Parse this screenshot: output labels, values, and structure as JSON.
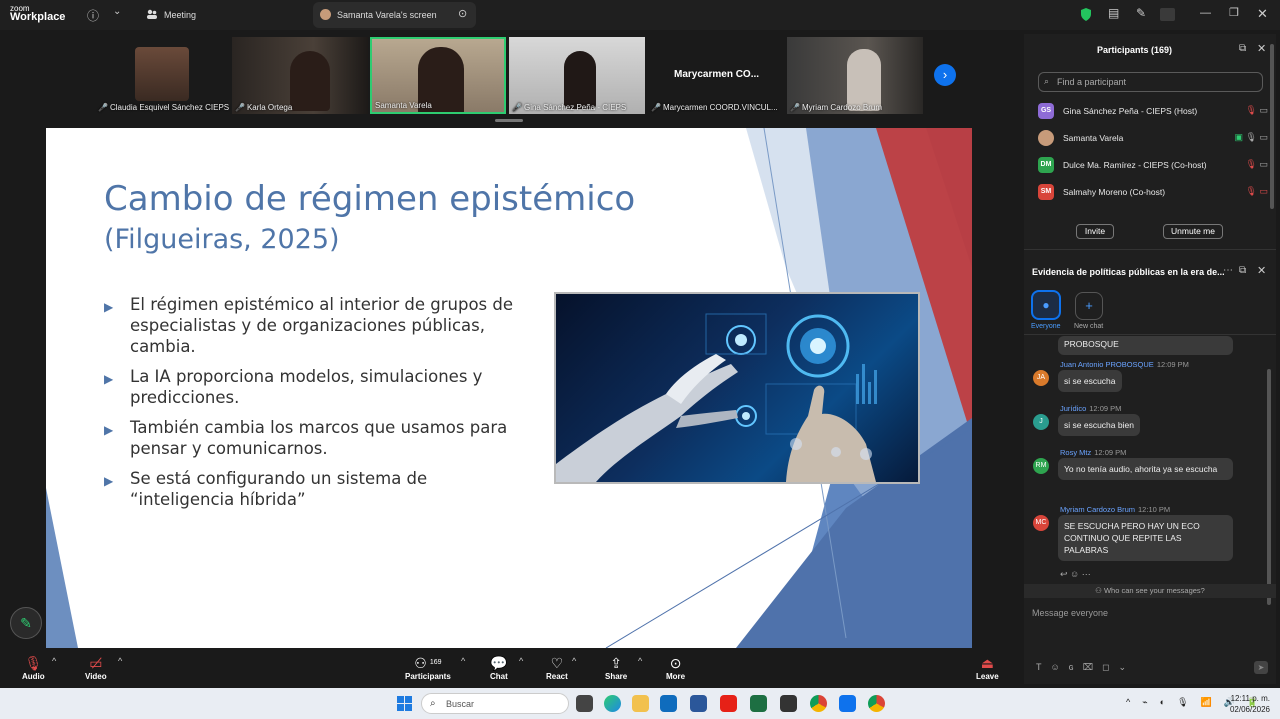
{
  "titlebar": {
    "logo_top": "zoom",
    "logo_bottom": "Workplace",
    "meeting_tab": "Meeting",
    "screen_tab": "Samanta Varela's screen"
  },
  "participants_strip": [
    {
      "name": "Claudia Esquivel Sánchez CIEPS",
      "muted": true
    },
    {
      "name": "Karla Ortega",
      "muted": true
    },
    {
      "name": "Samanta Varela",
      "muted": false
    },
    {
      "name": "Gina Sánchez Peña - CIEPS",
      "muted": true
    },
    {
      "name": "Marycarmen COORD.VINCUL...",
      "muted": true,
      "display": "Marycarmen  CO..."
    },
    {
      "name": "Myriam Cardozo Brum",
      "muted": true
    }
  ],
  "slide": {
    "title_main": "Cambio de régimen epistémico",
    "title_cite": "(Filgueiras, 2025)",
    "bullets": [
      "El régimen epistémico al interior de grupos de especialistas y de organizaciones públicas, cambia.",
      "La IA proporciona modelos, simulaciones y predicciones.",
      "También cambia los marcos que usamos para pensar y comunicarnos.",
      "Se está configurando un sistema de “inteligencia híbrida”"
    ]
  },
  "participants_panel": {
    "title": "Participants (169)",
    "search_placeholder": "Find a participant",
    "people": [
      {
        "initials": "GS",
        "name": "Gina Sánchez Peña - CIEPS (Host)",
        "color": "#8e6bd6"
      },
      {
        "initials": "",
        "name": "Samanta Varela",
        "color": "#c79b7a"
      },
      {
        "initials": "DM",
        "name": "Dulce Ma. Ramírez - CIEPS (Co-host)",
        "color": "#2ea44f"
      },
      {
        "initials": "SM",
        "name": "Salmahy Moreno (Co-host)",
        "color": "#d8453a"
      }
    ],
    "invite_label": "Invite",
    "unmute_label": "Unmute me"
  },
  "chat_panel": {
    "title": "Evidencia de políticas públicas en la era de...",
    "tab_everyone": "Everyone",
    "tab_new_chat": "New chat",
    "partial_message": "PROBOSQUE",
    "messages": [
      {
        "initials": "JA",
        "color": "#d97a2b",
        "sender": "Juan Antonio PROBOSQUE",
        "time": "12:09 PM",
        "text": "si se escucha"
      },
      {
        "initials": "J",
        "color": "#2a9d8f",
        "sender": "Jurídico",
        "time": "12:09 PM",
        "text": "si se escucha bien"
      },
      {
        "initials": "RM",
        "color": "#2ea44f",
        "sender": "Rosy Mtz",
        "time": "12:09 PM",
        "text": "Yo no tenía audio, ahorita ya se escucha"
      },
      {
        "initials": "MC",
        "color": "#d8453a",
        "sender": "Myriam Cardozo Brum",
        "time": "12:10 PM",
        "text": "SE ESCUCHA PERO HAY UN ECO CONTINUO QUE REPITE LAS PALABRAS"
      }
    ],
    "who_can_see": "Who can see your messages?",
    "input_placeholder": "Message everyone"
  },
  "toolbar": {
    "audio": "Audio",
    "video": "Video",
    "participants": "Participants",
    "participants_count": "169",
    "chat": "Chat",
    "react": "React",
    "share": "Share",
    "more": "More",
    "leave": "Leave"
  },
  "taskbar": {
    "search_placeholder": "Buscar",
    "time": "12:11 p. m.",
    "date": "02/06/2026"
  }
}
